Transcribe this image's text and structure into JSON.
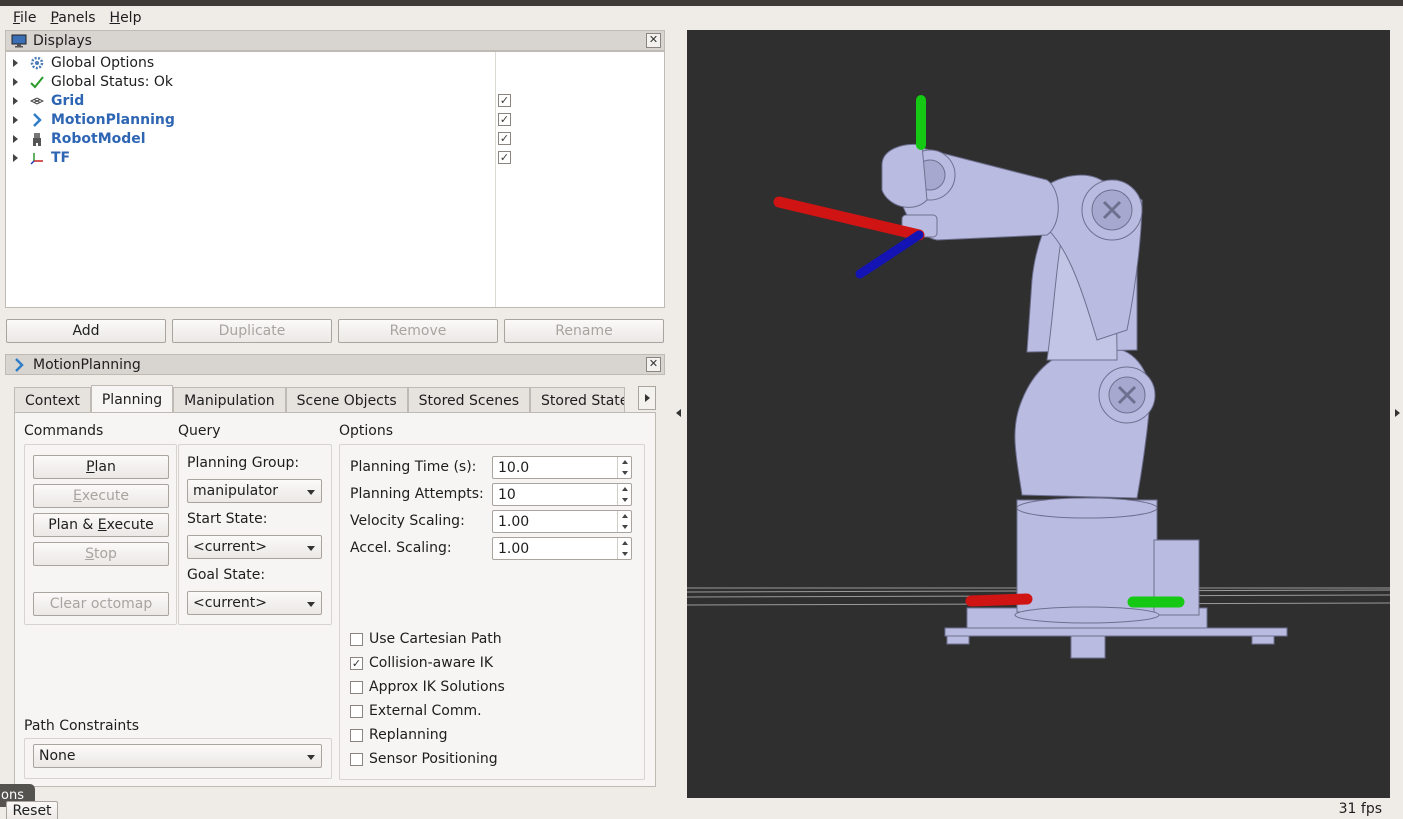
{
  "menubar": {
    "items": [
      {
        "pre": "",
        "key": "F",
        "rest": "ile"
      },
      {
        "pre": "",
        "key": "P",
        "rest": "anels"
      },
      {
        "pre": "",
        "key": "H",
        "rest": "elp"
      }
    ]
  },
  "displays": {
    "title": "Displays",
    "items": [
      {
        "label": "Global Options",
        "icon": "gear-icon",
        "checked": null
      },
      {
        "label": "Global Status: Ok",
        "icon": "check-icon",
        "checked": null
      },
      {
        "label": "Grid",
        "icon": "grid-icon",
        "checked": true
      },
      {
        "label": "MotionPlanning",
        "icon": "motion-planning-icon",
        "checked": true
      },
      {
        "label": "RobotModel",
        "icon": "robot-icon",
        "checked": true
      },
      {
        "label": "TF",
        "icon": "axes-icon",
        "checked": true
      }
    ],
    "buttons": {
      "add": "Add",
      "duplicate": "Duplicate",
      "remove": "Remove",
      "rename": "Rename"
    }
  },
  "motion_panel": {
    "title": "MotionPlanning",
    "tabs": [
      "Context",
      "Planning",
      "Manipulation",
      "Scene Objects",
      "Stored Scenes",
      "Stored State"
    ],
    "active_tab": "Planning",
    "commands": {
      "title": "Commands",
      "plan": {
        "key": "P",
        "rest": "lan"
      },
      "execute": {
        "pre": "",
        "key": "E",
        "rest": "xecute"
      },
      "plan_execute": {
        "pre": "Plan & ",
        "key": "E",
        "rest": "xecute"
      },
      "stop": {
        "key": "S",
        "rest": "top"
      },
      "clear_octomap": "Clear octomap"
    },
    "query": {
      "title": "Query",
      "planning_group_label": "Planning Group:",
      "planning_group_value": "manipulator",
      "start_state_label": "Start State:",
      "start_state_value": "<current>",
      "goal_state_label": "Goal State:",
      "goal_state_value": "<current>"
    },
    "options": {
      "title": "Options",
      "planning_time_label": "Planning Time (s):",
      "planning_time_value": "10.0",
      "planning_attempts_label": "Planning Attempts:",
      "planning_attempts_value": "10",
      "velocity_scaling_label": "Velocity Scaling:",
      "velocity_scaling_value": "1.00",
      "accel_scaling_label": "Accel. Scaling:",
      "accel_scaling_value": "1.00",
      "checkboxes": [
        {
          "label": "Use Cartesian Path",
          "checked": false
        },
        {
          "label": "Collision-aware IK",
          "checked": true
        },
        {
          "label": "Approx IK Solutions",
          "checked": false
        },
        {
          "label": "External Comm.",
          "checked": false
        },
        {
          "label": "Replanning",
          "checked": false
        },
        {
          "label": "Sensor Positioning",
          "checked": false
        }
      ]
    },
    "path_constraints": {
      "title": "Path Constraints",
      "value": "None"
    }
  },
  "bottom": {
    "tip": "ons",
    "reset": "Reset",
    "fps": "31 fps"
  },
  "colors": {
    "link_blue": "#2f66b4",
    "viewport_bg": "#2f2f2f",
    "robot": "#b9bbe0",
    "axis_x": "#d01414",
    "axis_y": "#14c814",
    "axis_z": "#1414b4"
  }
}
